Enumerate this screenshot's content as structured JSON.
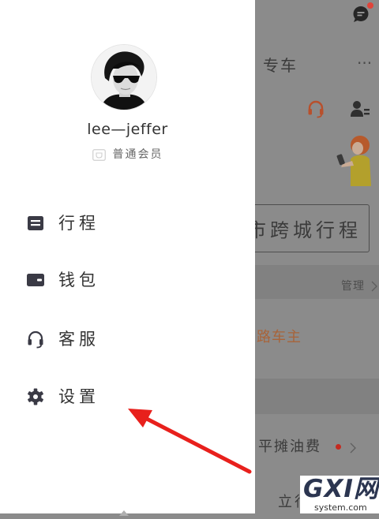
{
  "colors": {
    "drawer_bg": "#ffffff",
    "scrim_bg": "#8b8b8b",
    "text_dark": "#333333",
    "accent_orange": "#b0683a",
    "notification_red": "#e0443a",
    "annotation_red": "#e8201c"
  },
  "drawer": {
    "user": {
      "name": "lee—jeffer",
      "level": "普通会员"
    },
    "menu": [
      {
        "label": "行程",
        "icon": "itinerary-icon"
      },
      {
        "label": "钱包",
        "icon": "wallet-icon"
      },
      {
        "label": "客服",
        "icon": "headset-icon"
      },
      {
        "label": "设置",
        "icon": "gear-icon"
      }
    ],
    "footer_icon": "chevron-up-icon"
  },
  "background_page": {
    "header": {
      "tab": "专车",
      "more": "···"
    },
    "intercity_button": "市跨城行程",
    "section_manage": "管理",
    "driver_link": "路车主",
    "fuel_share_label": "平摊油费",
    "bottom_action": "立行"
  },
  "watermark": {
    "brand": "GXI网",
    "domain": "system.com"
  }
}
